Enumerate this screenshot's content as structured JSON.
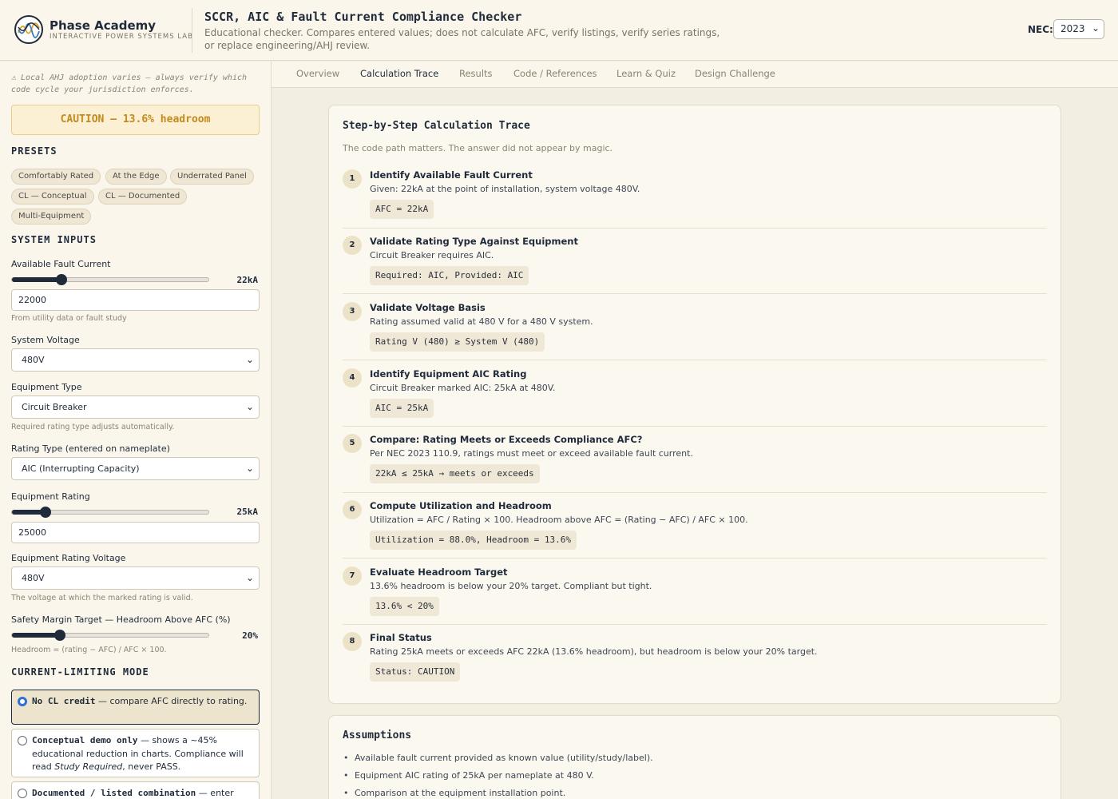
{
  "header": {
    "brand_name": "Phase Academy",
    "brand_sub": "INTERACTIVE POWER SYSTEMS LAB",
    "title": "SCCR, AIC & Fault Current Compliance Checker",
    "description": "Educational checker. Compares entered values; does not calculate AFC, verify listings, verify series ratings, or replace engineering/AHJ review.",
    "nec_label": "NEC:",
    "nec_value": "2023"
  },
  "sidebar": {
    "ahj_note": "⚠ Local AHJ adoption varies — always verify which code cycle your jurisdiction enforces.",
    "status_banner": "CAUTION — 13.6% headroom",
    "presets_title": "PRESETS",
    "presets": [
      "Comfortably Rated",
      "At the Edge",
      "Underrated Panel",
      "CL — Conceptual",
      "CL — Documented",
      "Multi-Equipment"
    ],
    "inputs_title": "SYSTEM INPUTS",
    "afc": {
      "label": "Available Fault Current",
      "display": "22kA",
      "value": "22000",
      "hint": "From utility data or fault study",
      "slider_fraction": 0.25
    },
    "voltage": {
      "label": "System Voltage",
      "value": "480V"
    },
    "equipment_type": {
      "label": "Equipment Type",
      "value": "Circuit Breaker",
      "hint": "Required rating type adjusts automatically."
    },
    "rating_type": {
      "label": "Rating Type (entered on nameplate)",
      "value": "AIC (Interrupting Capacity)"
    },
    "equipment_rating": {
      "label": "Equipment Rating",
      "display": "25kA",
      "value": "25000",
      "slider_fraction": 0.17
    },
    "rating_voltage": {
      "label": "Equipment Rating Voltage",
      "value": "480V",
      "hint": "The voltage at which the marked rating is valid."
    },
    "safety_margin": {
      "label": "Safety Margin Target — Headroom Above AFC (%)",
      "display": "20%",
      "hint": "Headroom = (rating − AFC) / AFC × 100.",
      "slider_fraction": 0.24
    },
    "cl_title": "CURRENT-LIMITING MODE",
    "cl_options": [
      {
        "code": "No CL credit",
        "text": " — compare AFC directly to rating.",
        "selected": true
      },
      {
        "code": "Conceptual demo only",
        "text": " — shows a ~45% educational reduction in charts. Compliance will read ",
        "italic": "Study Required",
        "tail": ", never PASS.",
        "selected": false
      },
      {
        "code": "Documented / listed combination",
        "text": " — enter",
        "selected": false
      }
    ]
  },
  "tabs": [
    "Overview",
    "Calculation Trace",
    "Results",
    "Code / References",
    "Learn & Quiz",
    "Design Challenge"
  ],
  "active_tab": "Calculation Trace",
  "trace": {
    "title": "Step-by-Step Calculation Trace",
    "subtitle": "The code path matters. The answer did not appear by magic.",
    "steps": [
      {
        "num": "1",
        "title": "Identify Available Fault Current",
        "desc": "Given: 22kA at the point of installation, system voltage 480V.",
        "formula": "AFC = 22kA"
      },
      {
        "num": "2",
        "title": "Validate Rating Type Against Equipment",
        "desc": "Circuit Breaker requires AIC.",
        "formula": "Required: AIC, Provided: AIC"
      },
      {
        "num": "3",
        "title": "Validate Voltage Basis",
        "desc": "Rating assumed valid at 480 V for a 480 V system.",
        "formula": "Rating V (480) ≥ System V (480)"
      },
      {
        "num": "4",
        "title": "Identify Equipment AIC Rating",
        "desc": "Circuit Breaker marked AIC: 25kA at 480V.",
        "formula": "AIC = 25kA"
      },
      {
        "num": "5",
        "title": "Compare: Rating Meets or Exceeds Compliance AFC?",
        "desc": "Per NEC 2023 110.9, ratings must meet or exceed available fault current.",
        "formula": "22kA ≤ 25kA → meets or exceeds"
      },
      {
        "num": "6",
        "title": "Compute Utilization and Headroom",
        "desc": "Utilization = AFC / Rating × 100. Headroom above AFC = (Rating − AFC) / AFC × 100.",
        "formula": "Utilization = 88.0%, Headroom = 13.6%"
      },
      {
        "num": "7",
        "title": "Evaluate Headroom Target",
        "desc": "13.6% headroom is below your 20% target. Compliant but tight.",
        "formula": "13.6% < 20%"
      },
      {
        "num": "8",
        "title": "Final Status",
        "desc": "Rating 25kA meets or exceeds AFC 22kA (13.6% headroom), but headroom is below your 20% target.",
        "formula": "Status: CAUTION"
      }
    ]
  },
  "assumptions": {
    "title": "Assumptions",
    "items": [
      "Available fault current provided as known value (utility/study/label).",
      "Equipment AIC rating of 25kA per nameplate at 480 V.",
      "Comparison at the equipment installation point."
    ]
  }
}
